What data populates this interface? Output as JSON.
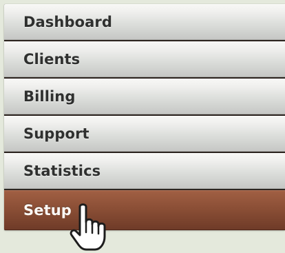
{
  "menu": {
    "items": [
      {
        "label": "Dashboard"
      },
      {
        "label": "Clients"
      },
      {
        "label": "Billing"
      },
      {
        "label": "Support"
      },
      {
        "label": "Statistics"
      },
      {
        "label": "Setup"
      }
    ],
    "active_item": "Setup"
  },
  "cursor": {
    "icon": "hand-pointer-icon"
  },
  "colors": {
    "background": "#e4e9dc",
    "item_gradient_top": "#f7f7f5",
    "item_gradient_bottom": "#c6c7c5",
    "item_text": "#2f302f",
    "active_item_top": "#a05f43",
    "active_item_bottom": "#6f3b28",
    "active_item_text": "#fbf8f5"
  }
}
